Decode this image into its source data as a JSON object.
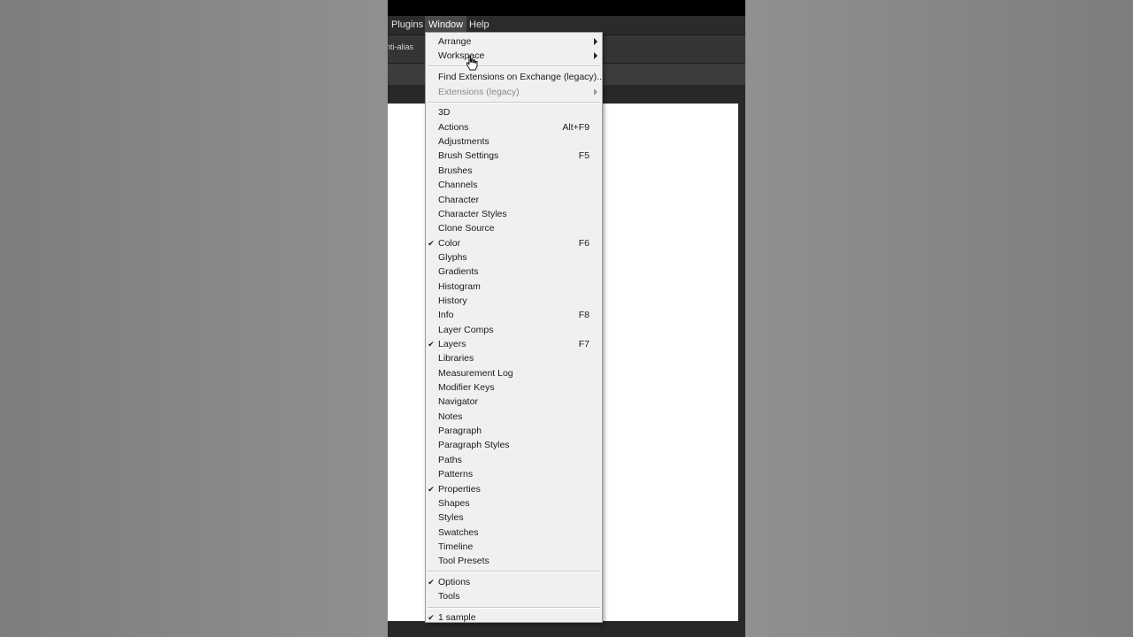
{
  "menubar": {
    "items": [
      {
        "label": "Plugins"
      },
      {
        "label": "Window",
        "active": true
      },
      {
        "label": "Help"
      }
    ]
  },
  "options_bar": {
    "anti_alias_label": "nti-alias"
  },
  "window_menu": {
    "groups": [
      [
        {
          "label": "Arrange",
          "submenu": true
        },
        {
          "label": "Workspace",
          "submenu": true
        }
      ],
      [
        {
          "label": "Find Extensions on Exchange (legacy)..."
        },
        {
          "label": "Extensions (legacy)",
          "submenu": true,
          "disabled": true
        }
      ],
      [
        {
          "label": "3D"
        },
        {
          "label": "Actions",
          "shortcut": "Alt+F9"
        },
        {
          "label": "Adjustments"
        },
        {
          "label": "Brush Settings",
          "shortcut": "F5"
        },
        {
          "label": "Brushes"
        },
        {
          "label": "Channels"
        },
        {
          "label": "Character"
        },
        {
          "label": "Character Styles"
        },
        {
          "label": "Clone Source"
        },
        {
          "label": "Color",
          "shortcut": "F6",
          "checked": true
        },
        {
          "label": "Glyphs"
        },
        {
          "label": "Gradients"
        },
        {
          "label": "Histogram"
        },
        {
          "label": "History"
        },
        {
          "label": "Info",
          "shortcut": "F8"
        },
        {
          "label": "Layer Comps"
        },
        {
          "label": "Layers",
          "shortcut": "F7",
          "checked": true
        },
        {
          "label": "Libraries"
        },
        {
          "label": "Measurement Log"
        },
        {
          "label": "Modifier Keys"
        },
        {
          "label": "Navigator"
        },
        {
          "label": "Notes"
        },
        {
          "label": "Paragraph"
        },
        {
          "label": "Paragraph Styles"
        },
        {
          "label": "Paths"
        },
        {
          "label": "Patterns"
        },
        {
          "label": "Properties",
          "checked": true
        },
        {
          "label": "Shapes"
        },
        {
          "label": "Styles"
        },
        {
          "label": "Swatches"
        },
        {
          "label": "Timeline"
        },
        {
          "label": "Tool Presets"
        }
      ],
      [
        {
          "label": "Options",
          "checked": true
        },
        {
          "label": "Tools"
        }
      ],
      [
        {
          "label": "1 sample",
          "checked": true
        }
      ]
    ]
  },
  "icons": {
    "check": "check-icon",
    "submenu": "chevron-right-icon",
    "cursor": "hand-cursor-icon"
  },
  "colors": {
    "menu_bg": "#f0f0f0",
    "menubar_bg": "#2b2b2b",
    "menubar_active": "#4a4a4a",
    "canvas": "#ffffff"
  }
}
